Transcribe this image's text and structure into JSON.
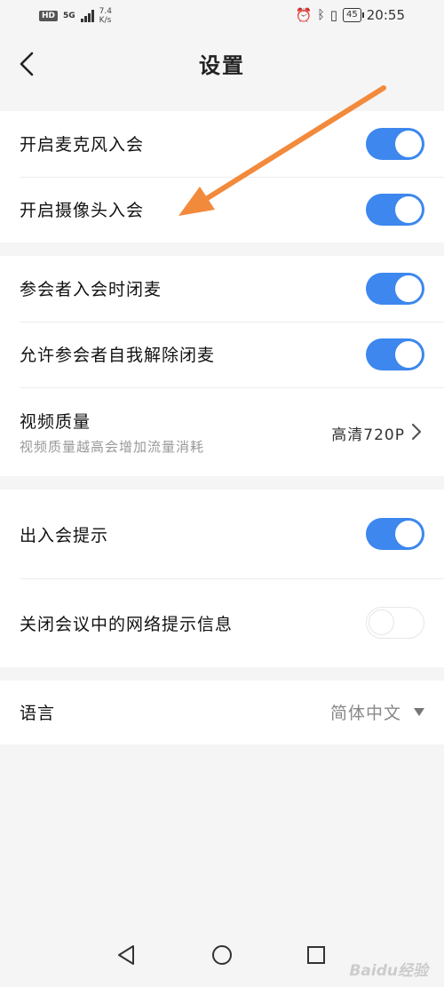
{
  "status_bar": {
    "hd": "HD",
    "network": "5G",
    "speed_value": "7.4",
    "speed_unit": "K/s",
    "battery": "45",
    "time": "20:55"
  },
  "header": {
    "title": "设置"
  },
  "settings": {
    "mic_join": {
      "label": "开启麦克风入会",
      "on": true
    },
    "camera_join": {
      "label": "开启摄像头入会",
      "on": true
    },
    "mute_on_join": {
      "label": "参会者入会时闭麦",
      "on": true
    },
    "allow_unmute": {
      "label": "允许参会者自我解除闭麦",
      "on": true
    },
    "video_quality": {
      "label": "视频质量",
      "subtitle": "视频质量越高会增加流量消耗",
      "value": "高清720P"
    },
    "join_leave_tip": {
      "label": "出入会提示",
      "on": true
    },
    "network_tip_off": {
      "label": "关闭会议中的网络提示信息",
      "on": false
    },
    "language": {
      "label": "语言",
      "value": "简体中文"
    }
  },
  "colors": {
    "accent": "#3d87ee",
    "annotation_arrow": "#f28a3c"
  },
  "watermark": "Baidu经验"
}
